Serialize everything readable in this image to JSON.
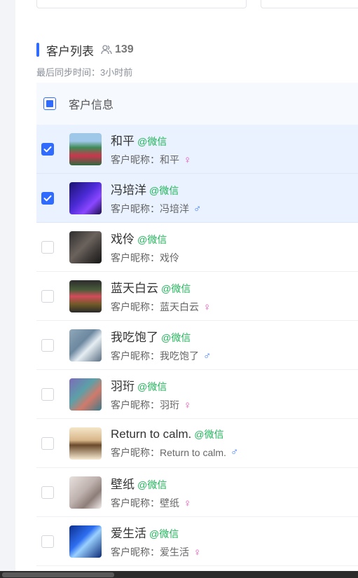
{
  "header": {
    "title": "客户列表",
    "count": "139",
    "sync": "最后同步时间：3小时前"
  },
  "table": {
    "column_label": "客户信息",
    "nickname_prefix": "客户昵称：",
    "rows": [
      {
        "name": "和平",
        "tag": "@微信",
        "nickname": "和平",
        "gender": "♀",
        "checked": true
      },
      {
        "name": "冯培洋",
        "tag": "@微信",
        "nickname": "冯培洋",
        "gender": "♂",
        "checked": true
      },
      {
        "name": "戏伶",
        "tag": "@微信",
        "nickname": "戏伶",
        "gender": "",
        "checked": false
      },
      {
        "name": "蓝天白云",
        "tag": "@微信",
        "nickname": "蓝天白云",
        "gender": "♀",
        "checked": false
      },
      {
        "name": "我吃饱了",
        "tag": "@微信",
        "nickname": "我吃饱了",
        "gender": "♂",
        "checked": false
      },
      {
        "name": "羽珩",
        "tag": "@微信",
        "nickname": "羽珩",
        "gender": "♀",
        "checked": false
      },
      {
        "name": "Return to calm.",
        "tag": "@微信",
        "nickname": "Return to calm.",
        "gender": "♂",
        "checked": false
      },
      {
        "name": "壁纸",
        "tag": "@微信",
        "nickname": "壁纸",
        "gender": "♀",
        "checked": false
      },
      {
        "name": "爱生活",
        "tag": "@微信",
        "nickname": "爱生活",
        "gender": "♀",
        "checked": false
      }
    ]
  },
  "colors": {
    "accent": "#2f6bff",
    "wechat_tag": "#21b35a",
    "female": "#e04fb5",
    "male": "#3d7bff",
    "selected_row": "#e9f2fe"
  },
  "icons": {
    "count": "users-icon",
    "checked": "check-icon",
    "female": "female-icon",
    "male": "male-icon"
  }
}
